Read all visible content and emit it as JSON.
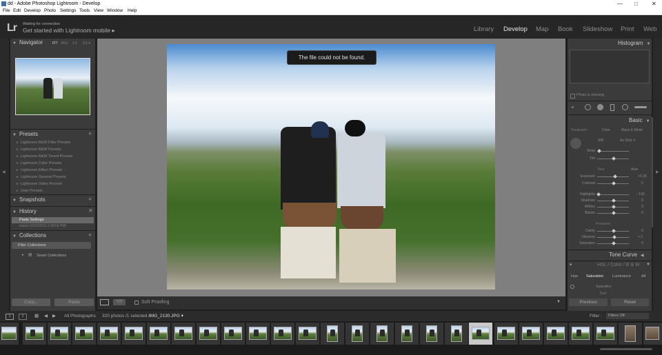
{
  "window": {
    "title": "dd - Adobe Photoshop Lightroom - Develop"
  },
  "menu": [
    "File",
    "Edit",
    "Develop",
    "Photo",
    "Settings",
    "Tools",
    "View",
    "Window",
    "Help"
  ],
  "identity": {
    "logo": "Lr",
    "status": "Waiting for connection",
    "promo": "Get started with Lightroom mobile ▸"
  },
  "modules": [
    "Library",
    "Develop",
    "Map",
    "Book",
    "Slideshow",
    "Print",
    "Web"
  ],
  "active_module": "Develop",
  "left": {
    "navigator": {
      "title": "Navigator",
      "zoom": [
        "FIT",
        "FILL",
        "1:1",
        "3:1 ▾"
      ]
    },
    "presets": {
      "title": "Presets",
      "items": [
        "Lightroom B&W Filter Presets",
        "Lightroom B&W Presets",
        "Lightroom B&W Toned Presets",
        "Lightroom Color Presets",
        "Lightroom Effect Presets",
        "Lightroom General Presets",
        "Lightroom Video Presets",
        "User Presets"
      ]
    },
    "snapshots": {
      "title": "Snapshots"
    },
    "history": {
      "title": "History",
      "items": [
        "Paste Settings",
        "Import (6/23/2016 5:08:56 PM)"
      ]
    },
    "collections": {
      "title": "Collections",
      "items": [
        "Filter Collections",
        "Smart Collections"
      ]
    },
    "copy_label": "Copy...",
    "paste_label": "Paste"
  },
  "center": {
    "toast": "The file could not be found.",
    "soft_proofing": "Soft Proofing"
  },
  "right": {
    "histogram": {
      "title": "Histogram",
      "missing": "Photo is missing"
    },
    "basic": {
      "title": "Basic",
      "treatment_label": "Treatment :",
      "treatment_options": [
        "Color",
        "Black & White"
      ],
      "wb_label": "WB :",
      "wb_value": "As Shot ≑",
      "temp": "Temp",
      "tint": "Tint",
      "tone_label": "Tone",
      "auto": "Auto",
      "exposure": "Exposure",
      "exposure_val": "+0.35",
      "contrast": "Contrast",
      "contrast_val": "0",
      "highlights": "Highlights",
      "highlights_val": "− 100",
      "shadows": "Shadows",
      "shadows_val": "0",
      "whites": "Whites",
      "whites_val": "0",
      "blacks": "Blacks",
      "blacks_val": "0",
      "presence_label": "Presence",
      "clarity": "Clarity",
      "clarity_val": "0",
      "vibrance": "Vibrance",
      "vibrance_val": "+ 2",
      "saturation": "Saturation",
      "saturation_val": "0"
    },
    "tone_curve": {
      "title": "Tone Curve"
    },
    "hsl": {
      "title": "HSL / Color / B & W",
      "tabs": [
        "Hue",
        "Saturation",
        "Luminance",
        "All"
      ],
      "section": "Saturation",
      "sub": "Red"
    },
    "previous_label": "Previous",
    "reset_label": "Reset"
  },
  "filmstrip": {
    "pages": [
      "1",
      "2"
    ],
    "source": "All Photographs",
    "count": "320 photos /1 selected /",
    "filename": "IMG_2130.JPG ▾",
    "filter_label": "Filter :",
    "filter_value": "Filters Off"
  },
  "colors": {
    "panel": "#3b3b3b",
    "background": "#1f1f1f",
    "active_text": "#e8e8e8"
  },
  "icons": [
    "lightroom-logo-icon",
    "minimize-icon",
    "maximize-icon",
    "close-icon",
    "crop-icon",
    "spot-removal-icon",
    "red-eye-icon",
    "graduated-filter-icon",
    "radial-filter-icon",
    "adjustment-brush-icon",
    "white-balance-picker-icon",
    "grid-view-icon",
    "back-arrow-icon",
    "forward-arrow-icon"
  ]
}
